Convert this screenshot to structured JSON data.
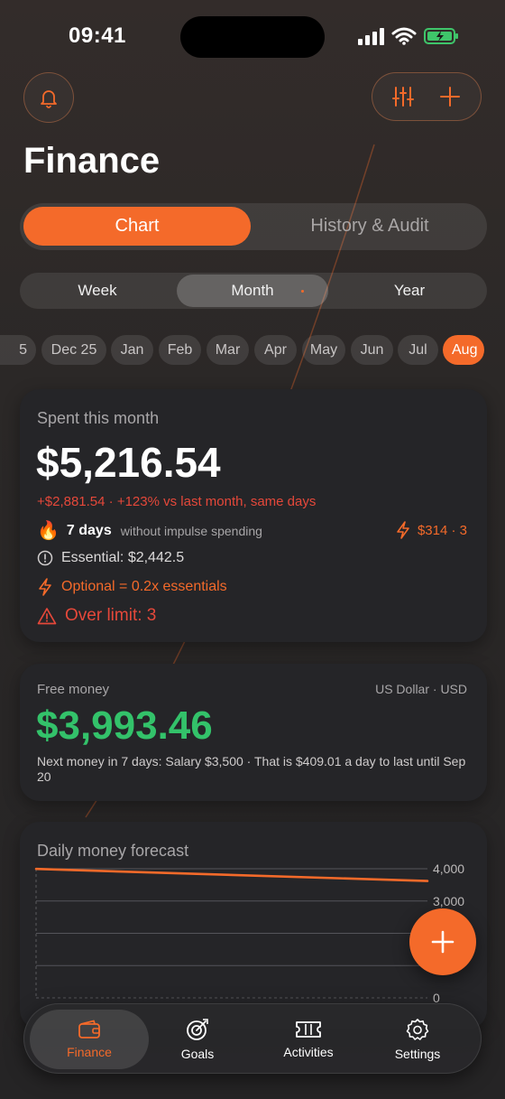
{
  "status_bar": {
    "time": "09:41"
  },
  "header": {
    "title": "Finance"
  },
  "view_tabs": [
    {
      "label": "Chart",
      "active": true
    },
    {
      "label": "History & Audit",
      "active": false
    }
  ],
  "period_tabs": [
    {
      "label": "Week",
      "active": false
    },
    {
      "label": "Month",
      "active": true
    },
    {
      "label": "Year",
      "active": false
    }
  ],
  "months": [
    "5",
    "Dec 25",
    "Jan",
    "Feb",
    "Mar",
    "Apr",
    "May",
    "Jun",
    "Jul",
    "Aug"
  ],
  "active_month": "Aug",
  "spent": {
    "label": "Spent this month",
    "amount": "$5,216.54",
    "delta": "+$2,881.54 · +123% vs last month, same days",
    "streak_days": "7 days",
    "streak_text": "without impulse spending",
    "impulse_summary": "$314 · 3",
    "essential": "Essential: $2,442.5",
    "optional": "Optional = 0.2x essentials",
    "over_limit": "Over limit: 3"
  },
  "free_money": {
    "label": "Free money",
    "currency": "US Dollar · USD",
    "amount": "$3,993.46",
    "note": "Next money in 7 days: Salary $3,500 · That is $409.01 a day to last until Sep 20"
  },
  "forecast": {
    "title": "Daily money forecast",
    "y_ticks": [
      "4,000",
      "3,000",
      "0"
    ]
  },
  "chart_data": {
    "type": "line",
    "title": "Daily money forecast",
    "xlabel": "",
    "ylabel": "",
    "ylim": [
      0,
      4000
    ],
    "y_ticks": [
      4000,
      3000,
      0
    ],
    "grid": true,
    "series": [
      {
        "values": [
          3993.46,
          3620
        ]
      }
    ]
  },
  "bottom_nav": [
    {
      "label": "Finance",
      "icon": "wallet-icon",
      "active": true
    },
    {
      "label": "Goals",
      "icon": "target-icon",
      "active": false
    },
    {
      "label": "Activities",
      "icon": "ticket-icon",
      "active": false
    },
    {
      "label": "Settings",
      "icon": "gear-icon",
      "active": false
    }
  ],
  "colors": {
    "accent": "#f46a2a",
    "danger": "#e5483a",
    "positive": "#33c26a",
    "card": "#252528"
  }
}
